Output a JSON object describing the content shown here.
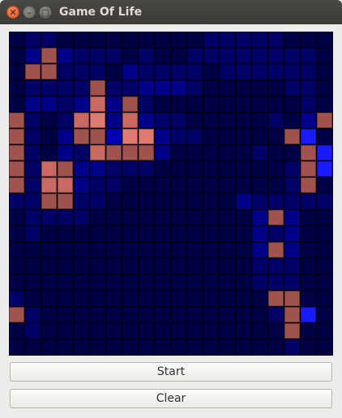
{
  "window": {
    "title": "Game Of Life",
    "close_glyph": "✕",
    "minimize_glyph": "–",
    "maximize_glyph": "▢"
  },
  "controls": {
    "start_label": "Start",
    "clear_label": "Clear"
  },
  "colors": {
    "alive": "#a0524e",
    "alive_bright": "#c86a63",
    "alive_brightest": "#e07a72",
    "dead_levels": [
      "#000028",
      "#000044",
      "#000066",
      "#000088",
      "#0000b4",
      "#1a1aff"
    ]
  },
  "grid": {
    "rows": 20,
    "cols": 20,
    "legend": "cell codes: . = dark background, 1-5 = brightness of dead cell (blue), a = alive cell, b = bright alive, c = brightest alive",
    "cells": [
      "12211111111122222111",
      "13a3222121122222222",
      "1aa22213222212222221",
      "12222a22333211111221",
      "13323b3a21111111112",
      "a212bc3b32211111213a",
      "a213aa4cc32211111a5",
      "a2132baaa311111211a5",
      "a2ba33222111111112a5",
      "a2bb32211111111112a",
      "22aa2211111111322222",
      "1222211111111113a311",
      "12111111111111132311",
      "1111111111111113a311",
      "11111111111111122211",
      "11111111111111122211",
      "2111111111111111aa11",
      "a2111111111111112a5",
      "12111111111111111a",
      "11111111111111111211"
    ]
  }
}
